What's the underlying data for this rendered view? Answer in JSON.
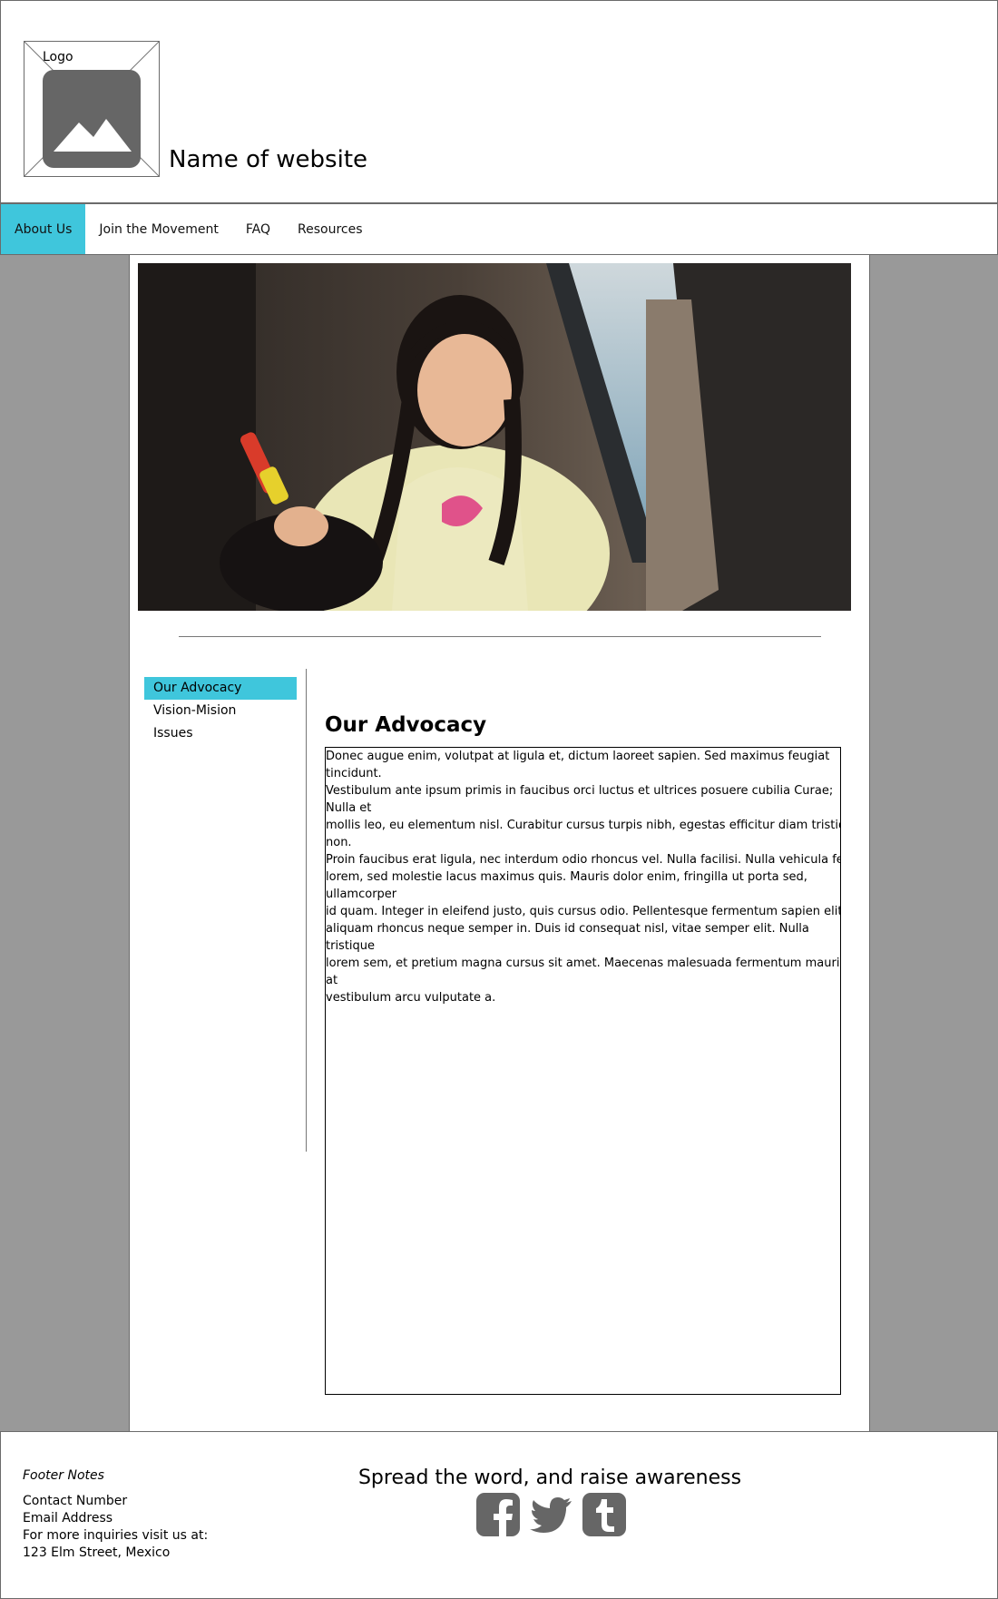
{
  "header": {
    "logo_label": "Logo",
    "site_name": "Name of website"
  },
  "nav": {
    "items": [
      {
        "label": "About Us",
        "active": true
      },
      {
        "label": "Join the Movement",
        "active": false
      },
      {
        "label": "FAQ",
        "active": false
      },
      {
        "label": "Resources",
        "active": false
      }
    ]
  },
  "sidebar": {
    "items": [
      {
        "label": "Our Advocacy",
        "active": true
      },
      {
        "label": "Vision-Mision",
        "active": false
      },
      {
        "label": "Issues",
        "active": false
      }
    ]
  },
  "main": {
    "heading": "Our Advocacy",
    "lines": [
      "Donec augue enim, volutpat at ligula et, dictum laoreet sapien. Sed maximus feugiat tincidunt.",
      "Vestibulum ante ipsum primis in faucibus orci luctus et ultrices posuere cubilia Curae; Nulla et",
      "mollis leo, eu elementum nisl. Curabitur cursus turpis nibh, egestas efficitur diam tristique non.",
      "Proin faucibus erat ligula, nec interdum odio rhoncus vel. Nulla facilisi. Nulla vehicula felis",
      "lorem, sed molestie lacus maximus quis. Mauris dolor enim, fringilla ut porta sed, ullamcorper",
      "id quam. Integer in eleifend justo, quis cursus odio. Pellentesque fermentum sapien elit,",
      "aliquam rhoncus neque semper in. Duis id consequat nisl, vitae semper elit. Nulla tristique",
      "lorem sem, et pretium magna cursus sit amet. Maecenas malesuada fermentum mauris, at",
      "vestibulum arcu vulputate a."
    ]
  },
  "footer": {
    "notes": "Footer Notes",
    "contact": "Contact Number",
    "email": "Email Address",
    "inquiries": "For more inquiries visit us at:",
    "address": "123 Elm Street, Mexico",
    "spread": "Spread the word, and raise awareness",
    "social_icons": [
      "facebook-icon",
      "twitter-icon",
      "tumblr-icon"
    ]
  },
  "colors": {
    "accent": "#3fc6dc",
    "background_gray": "#999999",
    "icon_gray": "#666666"
  }
}
